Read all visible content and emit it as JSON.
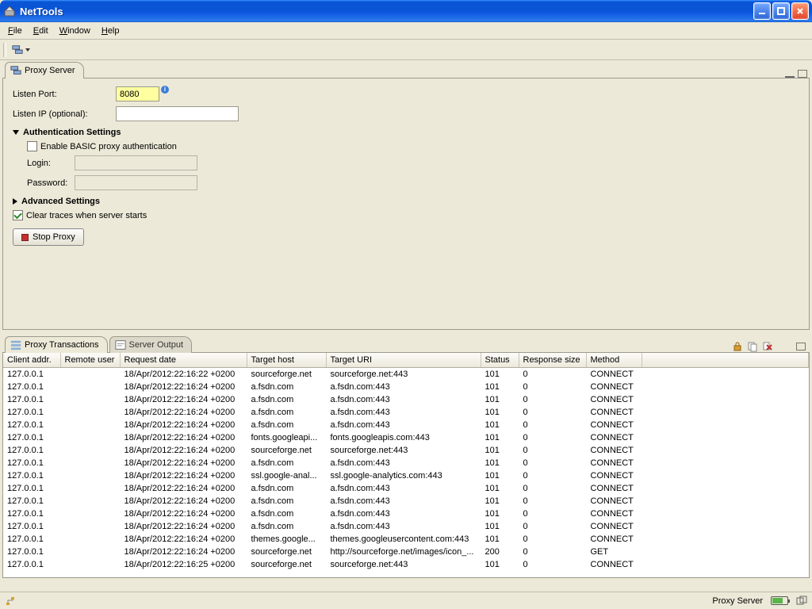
{
  "window": {
    "title": "NetTools"
  },
  "menu": {
    "file": "File",
    "edit": "Edit",
    "window": "Window",
    "help": "Help"
  },
  "upper_tab": {
    "label": "Proxy Server"
  },
  "form": {
    "listen_port_label": "Listen Port:",
    "listen_port_value": "8080",
    "listen_ip_label": "Listen IP (optional):",
    "listen_ip_value": "",
    "auth_section": "Authentication Settings",
    "enable_basic_auth": "Enable BASIC proxy authentication",
    "login_label": "Login:",
    "login_value": "",
    "password_label": "Password:",
    "password_value": "",
    "advanced_section": "Advanced Settings",
    "clear_traces": "Clear traces when server starts",
    "stop_proxy": "Stop Proxy"
  },
  "lower_tabs": {
    "transactions": "Proxy Transactions",
    "server_output": "Server Output"
  },
  "table": {
    "columns": [
      "Client addr.",
      "Remote user",
      "Request date",
      "Target host",
      "Target URI",
      "Status",
      "Response size",
      "Method"
    ],
    "rows": [
      [
        "127.0.0.1",
        "",
        "18/Apr/2012:22:16:22 +0200",
        "sourceforge.net",
        "sourceforge.net:443",
        "101",
        "0",
        "CONNECT"
      ],
      [
        "127.0.0.1",
        "",
        "18/Apr/2012:22:16:24 +0200",
        "a.fsdn.com",
        "a.fsdn.com:443",
        "101",
        "0",
        "CONNECT"
      ],
      [
        "127.0.0.1",
        "",
        "18/Apr/2012:22:16:24 +0200",
        "a.fsdn.com",
        "a.fsdn.com:443",
        "101",
        "0",
        "CONNECT"
      ],
      [
        "127.0.0.1",
        "",
        "18/Apr/2012:22:16:24 +0200",
        "a.fsdn.com",
        "a.fsdn.com:443",
        "101",
        "0",
        "CONNECT"
      ],
      [
        "127.0.0.1",
        "",
        "18/Apr/2012:22:16:24 +0200",
        "a.fsdn.com",
        "a.fsdn.com:443",
        "101",
        "0",
        "CONNECT"
      ],
      [
        "127.0.0.1",
        "",
        "18/Apr/2012:22:16:24 +0200",
        "fonts.googleapi...",
        "fonts.googleapis.com:443",
        "101",
        "0",
        "CONNECT"
      ],
      [
        "127.0.0.1",
        "",
        "18/Apr/2012:22:16:24 +0200",
        "sourceforge.net",
        "sourceforge.net:443",
        "101",
        "0",
        "CONNECT"
      ],
      [
        "127.0.0.1",
        "",
        "18/Apr/2012:22:16:24 +0200",
        "a.fsdn.com",
        "a.fsdn.com:443",
        "101",
        "0",
        "CONNECT"
      ],
      [
        "127.0.0.1",
        "",
        "18/Apr/2012:22:16:24 +0200",
        "ssl.google-anal...",
        "ssl.google-analytics.com:443",
        "101",
        "0",
        "CONNECT"
      ],
      [
        "127.0.0.1",
        "",
        "18/Apr/2012:22:16:24 +0200",
        "a.fsdn.com",
        "a.fsdn.com:443",
        "101",
        "0",
        "CONNECT"
      ],
      [
        "127.0.0.1",
        "",
        "18/Apr/2012:22:16:24 +0200",
        "a.fsdn.com",
        "a.fsdn.com:443",
        "101",
        "0",
        "CONNECT"
      ],
      [
        "127.0.0.1",
        "",
        "18/Apr/2012:22:16:24 +0200",
        "a.fsdn.com",
        "a.fsdn.com:443",
        "101",
        "0",
        "CONNECT"
      ],
      [
        "127.0.0.1",
        "",
        "18/Apr/2012:22:16:24 +0200",
        "a.fsdn.com",
        "a.fsdn.com:443",
        "101",
        "0",
        "CONNECT"
      ],
      [
        "127.0.0.1",
        "",
        "18/Apr/2012:22:16:24 +0200",
        "themes.google...",
        "themes.googleusercontent.com:443",
        "101",
        "0",
        "CONNECT"
      ],
      [
        "127.0.0.1",
        "",
        "18/Apr/2012:22:16:24 +0200",
        "sourceforge.net",
        "http://sourceforge.net/images/icon_...",
        "200",
        "0",
        "GET"
      ],
      [
        "127.0.0.1",
        "",
        "18/Apr/2012:22:16:25 +0200",
        "sourceforge.net",
        "sourceforge.net:443",
        "101",
        "0",
        "CONNECT"
      ]
    ]
  },
  "statusbar": {
    "server_label": "Proxy Server"
  }
}
